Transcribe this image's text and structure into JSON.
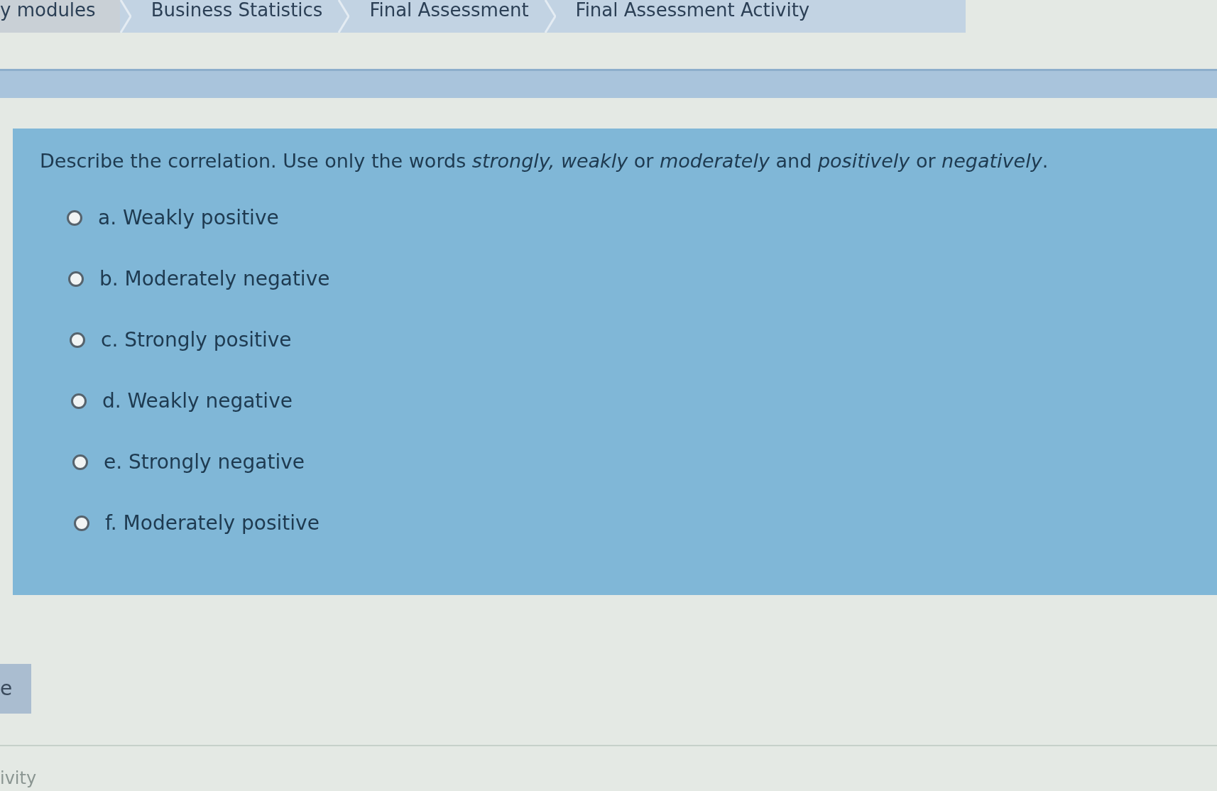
{
  "breadcrumb": [
    {
      "label": "y modules"
    },
    {
      "label": "Business Statistics"
    },
    {
      "label": "Final Assessment"
    },
    {
      "label": "Final Assessment Activity"
    }
  ],
  "question": {
    "text": "Describe the correlation. Use only the words *strongly, weakly* or *moderately* and *positively* or *negatively*.",
    "options": [
      {
        "label": "a. Weakly positive",
        "selected": false
      },
      {
        "label": "b. Moderately negative",
        "selected": false
      },
      {
        "label": "c. Strongly positive",
        "selected": false
      },
      {
        "label": "d. Weakly negative",
        "selected": false
      },
      {
        "label": "e. Strongly negative",
        "selected": false
      },
      {
        "label": "f. Moderately positive",
        "selected": false
      }
    ]
  },
  "side_tab": {
    "label": "e"
  },
  "footer": {
    "label": "ivity"
  }
}
